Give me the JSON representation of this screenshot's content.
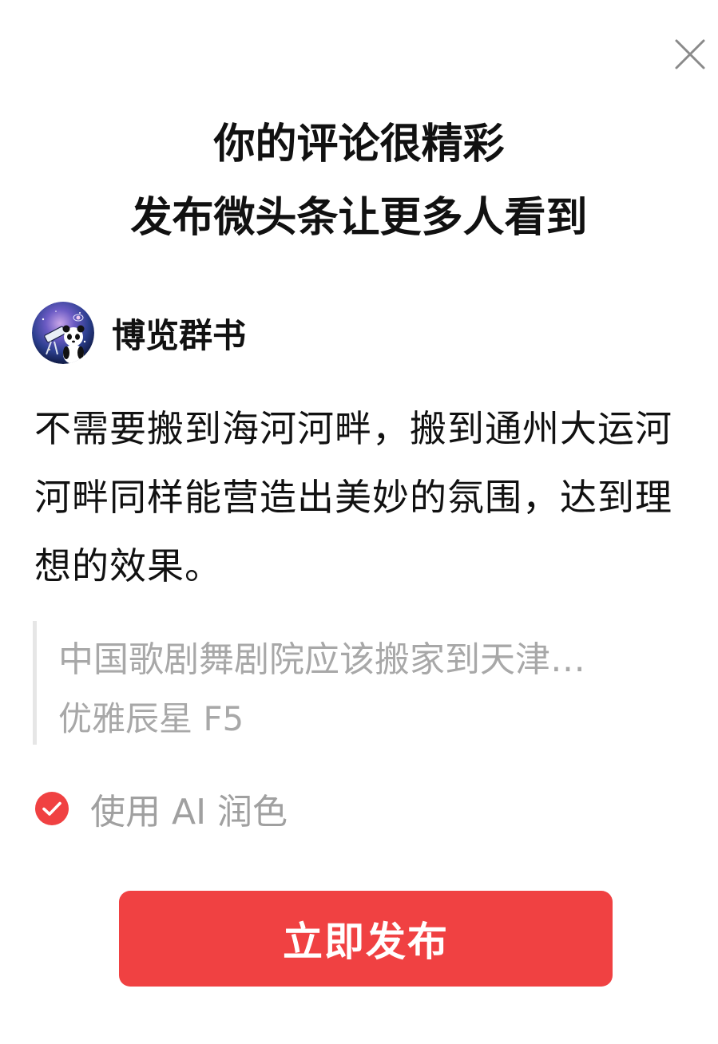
{
  "dialog": {
    "close_icon": "close-icon",
    "title_line1": "你的评论很精彩",
    "title_line2": "发布微头条让更多人看到"
  },
  "author": {
    "name": "博览群书",
    "avatar_icon": "panda-avatar"
  },
  "comment": {
    "text": "不需要搬到海河河畔，搬到通州大运河河畔同样能营造出美妙的氛围，达到理想的效果。"
  },
  "quote": {
    "text": "中国歌剧舞剧院应该搬家到天津…",
    "author": "优雅辰星 F5"
  },
  "ai_polish": {
    "label": "使用 AI 润色",
    "checked": true,
    "icon": "check-circle-icon"
  },
  "publish": {
    "label": "立即发布"
  },
  "colors": {
    "accent": "#f04142",
    "muted_text": "#a8a8a8",
    "text": "#111111",
    "quote_bar": "#e6e6e6"
  }
}
